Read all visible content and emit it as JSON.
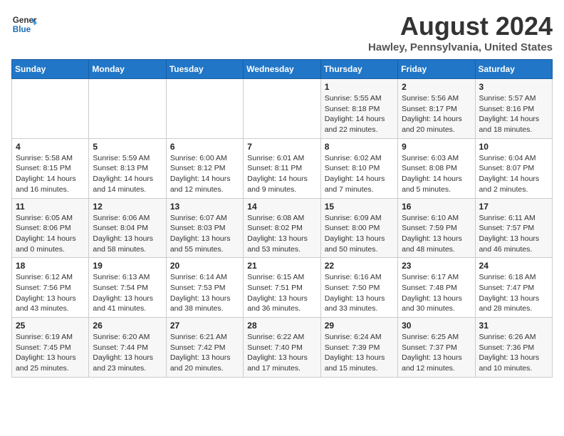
{
  "header": {
    "logo_line1": "General",
    "logo_line2": "Blue",
    "main_title": "August 2024",
    "subtitle": "Hawley, Pennsylvania, United States"
  },
  "days_of_week": [
    "Sunday",
    "Monday",
    "Tuesday",
    "Wednesday",
    "Thursday",
    "Friday",
    "Saturday"
  ],
  "weeks": [
    [
      {
        "day": "",
        "info": ""
      },
      {
        "day": "",
        "info": ""
      },
      {
        "day": "",
        "info": ""
      },
      {
        "day": "",
        "info": ""
      },
      {
        "day": "1",
        "info": "Sunrise: 5:55 AM\nSunset: 8:18 PM\nDaylight: 14 hours\nand 22 minutes."
      },
      {
        "day": "2",
        "info": "Sunrise: 5:56 AM\nSunset: 8:17 PM\nDaylight: 14 hours\nand 20 minutes."
      },
      {
        "day": "3",
        "info": "Sunrise: 5:57 AM\nSunset: 8:16 PM\nDaylight: 14 hours\nand 18 minutes."
      }
    ],
    [
      {
        "day": "4",
        "info": "Sunrise: 5:58 AM\nSunset: 8:15 PM\nDaylight: 14 hours\nand 16 minutes."
      },
      {
        "day": "5",
        "info": "Sunrise: 5:59 AM\nSunset: 8:13 PM\nDaylight: 14 hours\nand 14 minutes."
      },
      {
        "day": "6",
        "info": "Sunrise: 6:00 AM\nSunset: 8:12 PM\nDaylight: 14 hours\nand 12 minutes."
      },
      {
        "day": "7",
        "info": "Sunrise: 6:01 AM\nSunset: 8:11 PM\nDaylight: 14 hours\nand 9 minutes."
      },
      {
        "day": "8",
        "info": "Sunrise: 6:02 AM\nSunset: 8:10 PM\nDaylight: 14 hours\nand 7 minutes."
      },
      {
        "day": "9",
        "info": "Sunrise: 6:03 AM\nSunset: 8:08 PM\nDaylight: 14 hours\nand 5 minutes."
      },
      {
        "day": "10",
        "info": "Sunrise: 6:04 AM\nSunset: 8:07 PM\nDaylight: 14 hours\nand 2 minutes."
      }
    ],
    [
      {
        "day": "11",
        "info": "Sunrise: 6:05 AM\nSunset: 8:06 PM\nDaylight: 14 hours\nand 0 minutes."
      },
      {
        "day": "12",
        "info": "Sunrise: 6:06 AM\nSunset: 8:04 PM\nDaylight: 13 hours\nand 58 minutes."
      },
      {
        "day": "13",
        "info": "Sunrise: 6:07 AM\nSunset: 8:03 PM\nDaylight: 13 hours\nand 55 minutes."
      },
      {
        "day": "14",
        "info": "Sunrise: 6:08 AM\nSunset: 8:02 PM\nDaylight: 13 hours\nand 53 minutes."
      },
      {
        "day": "15",
        "info": "Sunrise: 6:09 AM\nSunset: 8:00 PM\nDaylight: 13 hours\nand 50 minutes."
      },
      {
        "day": "16",
        "info": "Sunrise: 6:10 AM\nSunset: 7:59 PM\nDaylight: 13 hours\nand 48 minutes."
      },
      {
        "day": "17",
        "info": "Sunrise: 6:11 AM\nSunset: 7:57 PM\nDaylight: 13 hours\nand 46 minutes."
      }
    ],
    [
      {
        "day": "18",
        "info": "Sunrise: 6:12 AM\nSunset: 7:56 PM\nDaylight: 13 hours\nand 43 minutes."
      },
      {
        "day": "19",
        "info": "Sunrise: 6:13 AM\nSunset: 7:54 PM\nDaylight: 13 hours\nand 41 minutes."
      },
      {
        "day": "20",
        "info": "Sunrise: 6:14 AM\nSunset: 7:53 PM\nDaylight: 13 hours\nand 38 minutes."
      },
      {
        "day": "21",
        "info": "Sunrise: 6:15 AM\nSunset: 7:51 PM\nDaylight: 13 hours\nand 36 minutes."
      },
      {
        "day": "22",
        "info": "Sunrise: 6:16 AM\nSunset: 7:50 PM\nDaylight: 13 hours\nand 33 minutes."
      },
      {
        "day": "23",
        "info": "Sunrise: 6:17 AM\nSunset: 7:48 PM\nDaylight: 13 hours\nand 30 minutes."
      },
      {
        "day": "24",
        "info": "Sunrise: 6:18 AM\nSunset: 7:47 PM\nDaylight: 13 hours\nand 28 minutes."
      }
    ],
    [
      {
        "day": "25",
        "info": "Sunrise: 6:19 AM\nSunset: 7:45 PM\nDaylight: 13 hours\nand 25 minutes."
      },
      {
        "day": "26",
        "info": "Sunrise: 6:20 AM\nSunset: 7:44 PM\nDaylight: 13 hours\nand 23 minutes."
      },
      {
        "day": "27",
        "info": "Sunrise: 6:21 AM\nSunset: 7:42 PM\nDaylight: 13 hours\nand 20 minutes."
      },
      {
        "day": "28",
        "info": "Sunrise: 6:22 AM\nSunset: 7:40 PM\nDaylight: 13 hours\nand 17 minutes."
      },
      {
        "day": "29",
        "info": "Sunrise: 6:24 AM\nSunset: 7:39 PM\nDaylight: 13 hours\nand 15 minutes."
      },
      {
        "day": "30",
        "info": "Sunrise: 6:25 AM\nSunset: 7:37 PM\nDaylight: 13 hours\nand 12 minutes."
      },
      {
        "day": "31",
        "info": "Sunrise: 6:26 AM\nSunset: 7:36 PM\nDaylight: 13 hours\nand 10 minutes."
      }
    ]
  ]
}
